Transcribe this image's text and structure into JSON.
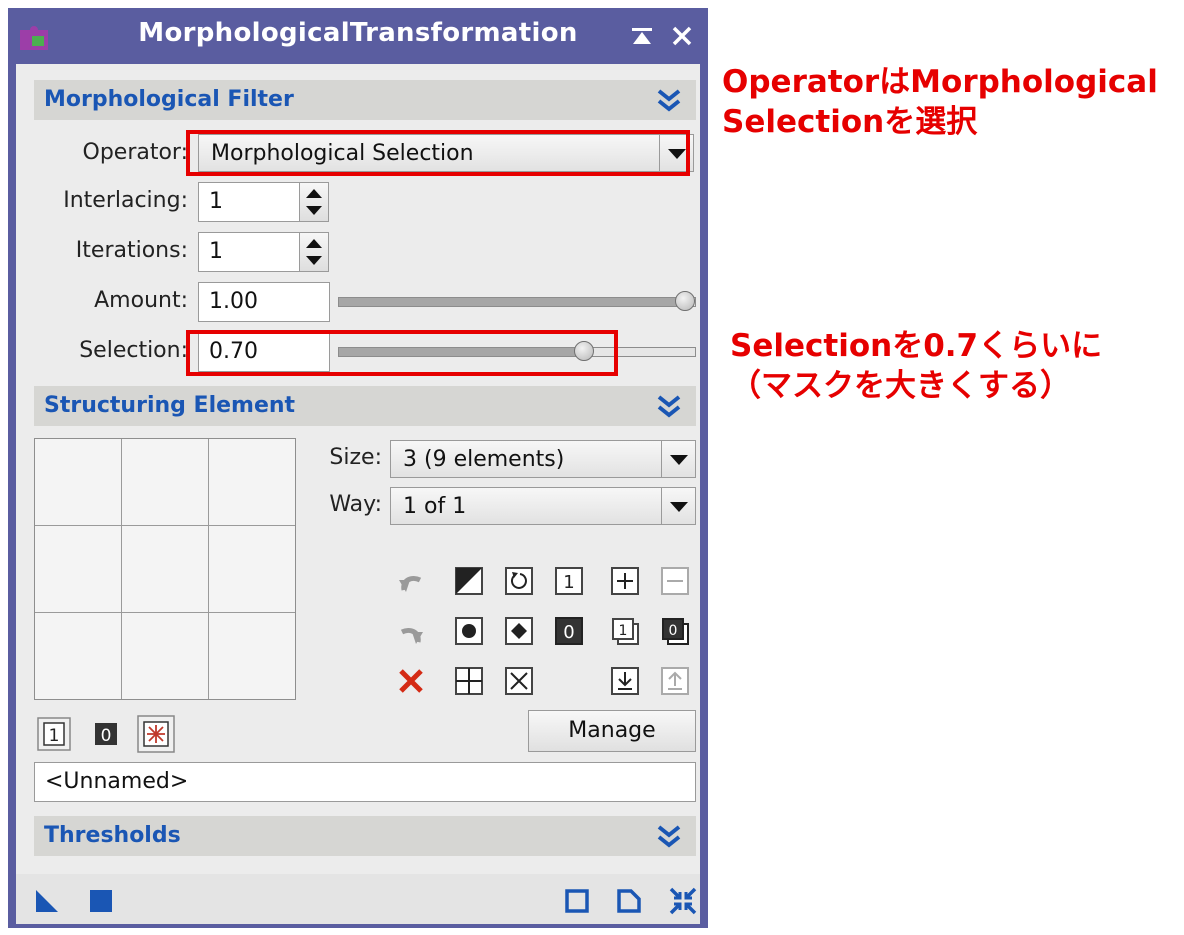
{
  "window": {
    "title": "MorphologicalTransformation",
    "accent": "#5a5da0",
    "section_color": "#1a56b4"
  },
  "sections": {
    "filter": "Morphological Filter",
    "structuring": "Structuring Element",
    "thresholds": "Thresholds"
  },
  "filter": {
    "operator_label": "Operator:",
    "operator_value": "Morphological Selection",
    "interlacing_label": "Interlacing:",
    "interlacing_value": "1",
    "iterations_label": "Iterations:",
    "iterations_value": "1",
    "amount_label": "Amount:",
    "amount_value": "1.00",
    "amount_level": 1.0,
    "selection_label": "Selection:",
    "selection_value": "0.70",
    "selection_level": 0.7
  },
  "structuring": {
    "size_label": "Size:",
    "size_value": "3  (9 elements)",
    "way_label": "Way:",
    "way_value": "1 of 1",
    "manage_label": "Manage",
    "name_value": "<Unnamed>",
    "tools": [
      "undo-icon",
      "fill-half-icon",
      "rotate-icon",
      "set-one-icon",
      "add-way-icon",
      "remove-way-icon",
      "redo-icon",
      "circle-icon",
      "diamond-icon",
      "set-zero-icon",
      "copy-one-icon",
      "copy-zero-icon",
      "clear-icon",
      "grid-plus-icon",
      "grid-x-icon",
      "import-icon",
      "export-icon"
    ],
    "bottom_tools": [
      "set-one-icon",
      "set-zero-icon",
      "star-icon"
    ]
  },
  "annotations": {
    "operator_note": [
      "OperatorはMorphological",
      "Selectionを選択"
    ],
    "selection_note": [
      "Selectionを0.7くらいに",
      "（マスクを大きくする）"
    ],
    "color": "#e60000"
  }
}
